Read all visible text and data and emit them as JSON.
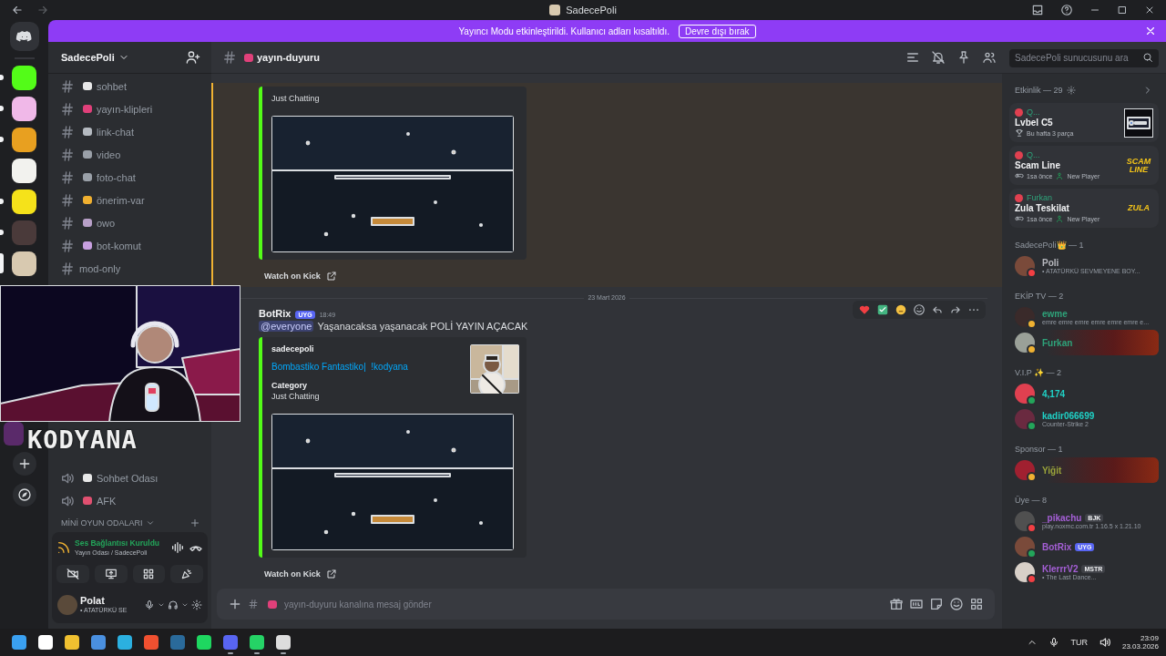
{
  "window": {
    "title": "SadecePoli"
  },
  "banner": {
    "text": "Yayıncı Modu etkinleştirildi. Kullanıcı adları kısaltıldı.",
    "button": "Devre dışı bırak"
  },
  "servers": [
    {
      "color": "#53fc18",
      "unread": true,
      "selected": false
    },
    {
      "color": "#f0b8e8",
      "unread": true,
      "selected": false
    },
    {
      "color": "#e8a020",
      "unread": true,
      "selected": false
    },
    {
      "color": "#f2f2ee",
      "unread": false,
      "selected": false
    },
    {
      "color": "#f5e21a",
      "unread": true,
      "selected": false
    },
    {
      "color": "#4a3a3a",
      "unread": true,
      "selected": false
    },
    {
      "color": "#d8c9b0",
      "unread": false,
      "selected": true
    }
  ],
  "server": {
    "name": "SadecePoli"
  },
  "channels": [
    {
      "name": "sohbet",
      "kind": "emoji"
    },
    {
      "name": "yayın-klipleri",
      "kind": "emoji"
    },
    {
      "name": "link-chat",
      "kind": "emoji"
    },
    {
      "name": "video",
      "kind": "emoji"
    },
    {
      "name": "foto-chat",
      "kind": "emoji"
    },
    {
      "name": "önerim-var",
      "kind": "emoji"
    },
    {
      "name": "owo",
      "kind": "emoji"
    },
    {
      "name": "bot-komut",
      "kind": "emoji"
    },
    {
      "name": "mod-only",
      "kind": "private"
    }
  ],
  "voice_channels": [
    {
      "name": "Sohbet Odası"
    },
    {
      "name": "AFK"
    }
  ],
  "category": "MİNİ OYUN ODALARI",
  "webcam": {
    "kind": "picture",
    "overlay_title": "KODYANA"
  },
  "voice_panel": {
    "status": "Ses Bağlantısı Kuruldu",
    "location": "Yayın Odası / SadecePoli"
  },
  "user": {
    "name": "Polat",
    "status": "• ATATÜRKÜ SE"
  },
  "channel_header": {
    "name": "yayın-duyuru"
  },
  "search": {
    "placeholder": "SadecePoli sunucusunu ara"
  },
  "messages": [
    {
      "mentioned": true,
      "embed": {
        "field_value": "Just Chatting"
      },
      "link": "Watch on Kick"
    },
    {
      "kind": "divider",
      "date": "23 Mart 2026"
    },
    {
      "mentioned": false,
      "author": "BotRix",
      "tag": "UYG",
      "time": "18:49",
      "mention": "@everyone",
      "text": "Yaşanacaksa yaşanacak POLİ YAYIN AÇACAK",
      "embed": {
        "provider": "sadecepoli",
        "title": "Bombastiko Fantastiko|  !kodyana",
        "field_label": "Category",
        "field_value": "Just Chatting",
        "thumbnail": true
      },
      "link": "Watch on Kick"
    }
  ],
  "composer": {
    "placeholder": "yayın-duyuru kanalına mesaj gönder"
  },
  "activity": {
    "title": "Etkinlik — 29",
    "cards": [
      {
        "user": "Q...",
        "title": "Lvbel C5",
        "meta": "Bu hafta 3 parça"
      },
      {
        "user": "Q...",
        "title": "Scam Line",
        "meta": "1sa önce",
        "extra": "New Player",
        "logo": "SCAM LINE"
      },
      {
        "user": "Furkan",
        "title": "Zula Teskilat",
        "meta": "1sa önce",
        "extra": "New Player",
        "logo": "ZULA"
      }
    ]
  },
  "member_groups": [
    {
      "title": "SadecePoli👑 — 1",
      "members": [
        {
          "name": "Poli",
          "color": "#b8b9bf",
          "presence": {
            "color": "#f23f43"
          },
          "sub": "• ATATÜRKÜ SEVMEYENE BOY...",
          "nameplate": false
        }
      ]
    },
    {
      "title": "EKİP TV — 2",
      "members": [
        {
          "name": "ewme",
          "color": "#2ea37a",
          "presence": {
            "color": "#f0b232"
          },
          "sub": "emre emre emre emre emre emre e...",
          "nameplate": false
        },
        {
          "name": "Furkan",
          "color": "#2ea37a",
          "presence": {
            "color": "#f0b232"
          },
          "nameplate": true
        }
      ]
    },
    {
      "title": "V.I.P ✨ — 2",
      "members": [
        {
          "name": "4,174",
          "color": "#1fd1c6",
          "presence": {
            "color": "#23a55a"
          },
          "nameplate": false
        },
        {
          "name": "kadir066699",
          "color": "#1fd1c6",
          "presence": {
            "color": "#23a55a"
          },
          "sub": "Counter-Strike 2",
          "nameplate": false
        }
      ]
    },
    {
      "title": "Sponsor — 1",
      "members": [
        {
          "name": "Yiğit",
          "color": "#9aa33a",
          "presence": {
            "color": "#f0b232"
          },
          "nameplate": true
        }
      ]
    },
    {
      "title": "Üye — 8",
      "members": [
        {
          "name": "_pikachu",
          "color": "#a55fd6",
          "presence": {
            "color": "#f23f43"
          },
          "badge": "BJK",
          "sub": "play.noxmc.com.tr 1.16.5 x 1.21.10",
          "nameplate": false
        },
        {
          "name": "BotRix",
          "color": "#a55fd6",
          "presence": {
            "color": "#23a55a"
          },
          "badge": "UYG",
          "nameplate": false
        },
        {
          "name": "KlerrrV2",
          "color": "#a55fd6",
          "presence": {
            "color": "#f23f43"
          },
          "badge": "MSTR",
          "sub": "• The Last Dance...",
          "nameplate": false
        }
      ]
    }
  ],
  "taskbar": {
    "apps": [
      {
        "running": false
      },
      {
        "running": false
      },
      {
        "running": false
      },
      {
        "running": false
      },
      {
        "running": false
      },
      {
        "running": false
      },
      {
        "running": false
      },
      {
        "running": false
      },
      {
        "running": true
      },
      {
        "running": true
      },
      {
        "running": true
      }
    ],
    "language": "TUR",
    "time": "23:09",
    "date": "23.03.2026"
  }
}
